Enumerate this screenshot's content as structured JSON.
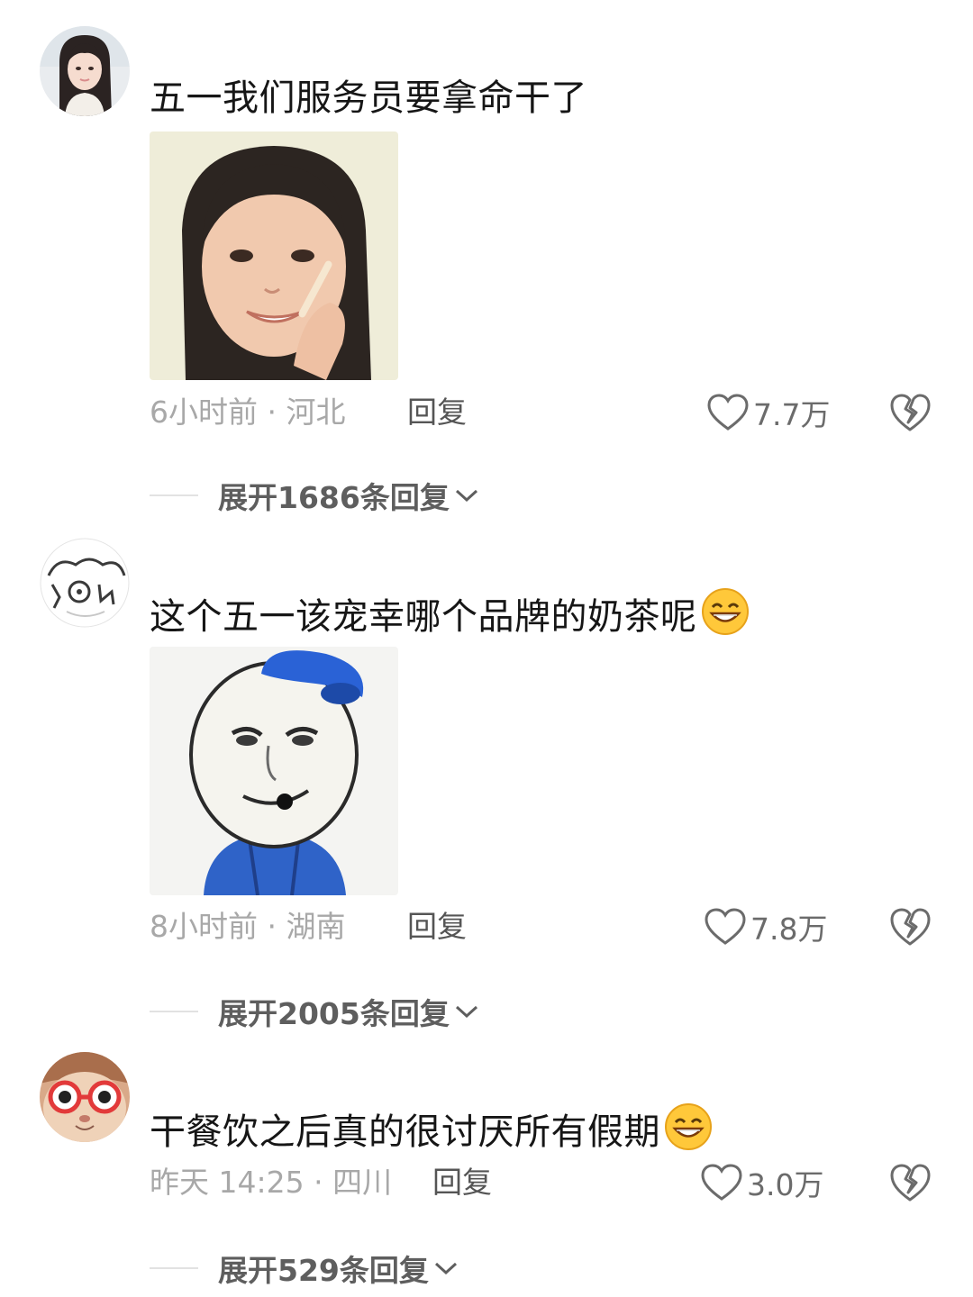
{
  "comments": [
    {
      "avatar_icon": "girl-portrait-avatar",
      "text": "五一我们服务员要拿命干了",
      "has_emoji": false,
      "sticker_icon": "smiling-girl-sticker",
      "time": "6小时前",
      "location": "河北",
      "reply_label": "回复",
      "likes": "7.7万",
      "expand_label": "展开1686条回复"
    },
    {
      "avatar_icon": "doodle-cat-avatar",
      "text": "这个五一该宠幸哪个品牌的奶茶呢",
      "has_emoji": true,
      "sticker_icon": "waiter-meme-sticker",
      "time": "8小时前",
      "location": "湖南",
      "reply_label": "回复",
      "likes": "7.8万",
      "expand_label": "展开2005条回复"
    },
    {
      "avatar_icon": "cat-with-glasses-avatar",
      "text": "干餐饮之后真的很讨厌所有假期",
      "has_emoji": true,
      "sticker_icon": "",
      "time": "昨天 14:25",
      "location": "四川",
      "reply_label": "回复",
      "likes": "3.0万",
      "expand_label": "展开529条回复"
    }
  ],
  "meta_separator": "·",
  "colors": {
    "text": "#161616",
    "meta": "#a8a8a8",
    "expand": "#5e5e5e",
    "icon": "#6b6b6b",
    "divider": "#e2e2e2",
    "emoji_yellow": "#ffc83a"
  }
}
